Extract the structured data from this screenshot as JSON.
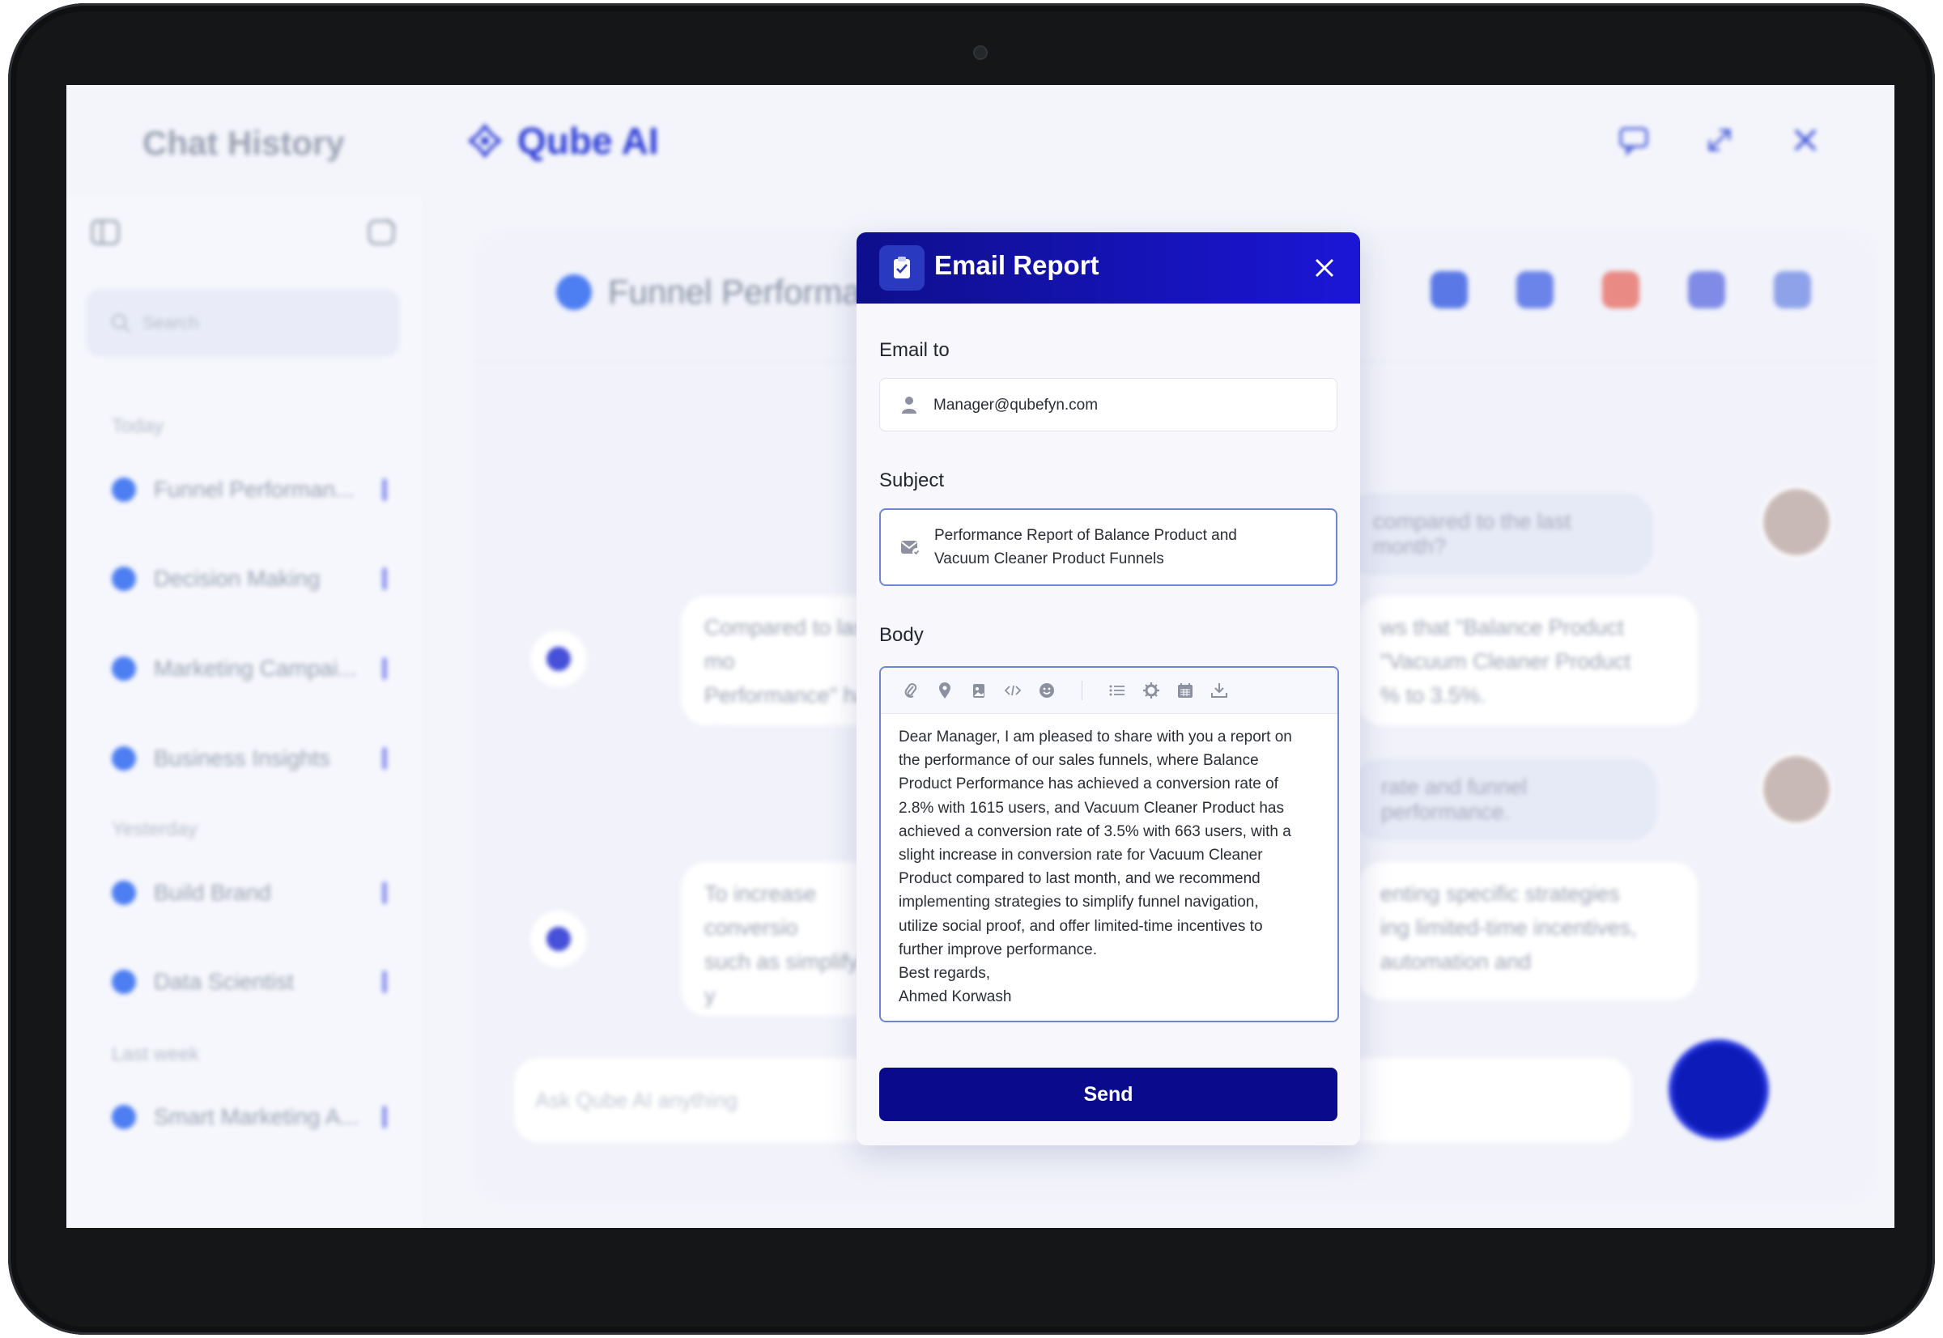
{
  "app": {
    "sidebar_title": "Chat History",
    "brand_name": "Qube AI",
    "search_placeholder": "Search",
    "groups": {
      "today": "Today",
      "yesterday": "Yesterday",
      "last_week": "Last week"
    },
    "chats": [
      {
        "label": "Funnel Performan..."
      },
      {
        "label": "Decision Making"
      },
      {
        "label": "Marketing Campai..."
      },
      {
        "label": "Business Insights"
      },
      {
        "label": "Build Brand"
      },
      {
        "label": "Data Scientist"
      },
      {
        "label": "Smart Marketing A..."
      }
    ],
    "chat_title": "Funnel Performa",
    "messages": {
      "user_1": "compared to the last month?",
      "bot_1_left": "Compared to last mo\nPerformance\" has ma\nPerformance\" has see",
      "bot_1_right": "ws that \"Balance Product\n\"Vacuum Cleaner Product\n% to 3.5%.",
      "user_2": "rate and funnel performance.",
      "bot_2_left": "To increase conversio\nsuch as simplifying y\nand creating a sense\npersonalized messag",
      "bot_2_right": "enting specific strategies\ning limited-time incentives,\n automation and"
    },
    "input_placeholder": "Ask Qube AI anything"
  },
  "modal": {
    "title": "Email Report",
    "email_label": "Email to",
    "email_value": "Manager@qubefyn.com",
    "subject_label": "Subject",
    "subject_value": "Performance Report of Balance Product and\nVacuum Cleaner Product Funnels",
    "body_label": "Body",
    "body_text": "Dear Manager, I am pleased to share with you a report on\nthe performance of our sales funnels, where Balance\nProduct Performance has achieved a conversion rate of\n2.8% with 1615 users, and Vacuum Cleaner Product has\nachieved a conversion rate of 3.5% with 663 users, with a\nslight increase in conversion rate for Vacuum Cleaner\nProduct compared to last month, and we recommend\nimplementing strategies to simplify funnel navigation,\nutilize social proof, and offer limited-time incentives to\nfurther improve performance.\nBest regards,\nAhmed Korwash",
    "send_label": "Send",
    "toolbar_icons": [
      "paperclip-icon",
      "location-icon",
      "image-icon",
      "code-icon",
      "emoji-icon",
      "list-icon",
      "settings-icon",
      "calendar-icon",
      "download-icon"
    ]
  },
  "colors": {
    "header_start": "#0e0f8c",
    "header_end": "#1b16d6",
    "send_button": "#0a0a8c",
    "focus_border": "#6d86d3",
    "brand": "#2e3fd6"
  }
}
